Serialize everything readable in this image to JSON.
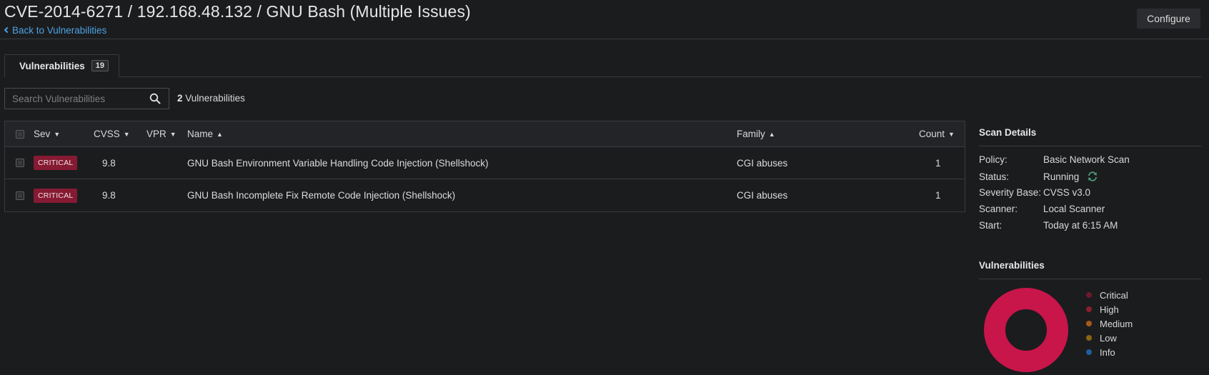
{
  "header": {
    "title": "CVE-2014-6271 / 192.168.48.132 / GNU Bash (Multiple Issues)",
    "back_label": "Back to Vulnerabilities",
    "configure_label": "Configure"
  },
  "tabs": [
    {
      "label": "Vulnerabilities",
      "count": "19"
    }
  ],
  "search": {
    "placeholder": "Search Vulnerabilities",
    "value": ""
  },
  "results": {
    "count": "2",
    "label": "Vulnerabilities"
  },
  "table": {
    "columns": {
      "sev": "Sev",
      "cvss": "CVSS",
      "vpr": "VPR",
      "name": "Name",
      "family": "Family",
      "count": "Count"
    },
    "sort_arrows": {
      "sev": "▼",
      "cvss": "▼",
      "vpr": "▼",
      "name": "▲",
      "family": "▲",
      "count": "▼"
    },
    "rows": [
      {
        "severity": "CRITICAL",
        "cvss": "9.8",
        "vpr": "",
        "name": "GNU Bash Environment Variable Handling Code Injection (Shellshock)",
        "family": "CGI abuses",
        "count": "1"
      },
      {
        "severity": "CRITICAL",
        "cvss": "9.8",
        "vpr": "",
        "name": "GNU Bash Incomplete Fix Remote Code Injection (Shellshock)",
        "family": "CGI abuses",
        "count": "1"
      }
    ]
  },
  "scan_details": {
    "title": "Scan Details",
    "fields": [
      {
        "key": "Policy:",
        "value": "Basic Network Scan"
      },
      {
        "key": "Status:",
        "value": "Running"
      },
      {
        "key": "Severity Base:",
        "value": "CVSS v3.0"
      },
      {
        "key": "Scanner:",
        "value": "Local Scanner"
      },
      {
        "key": "Start:",
        "value": "Today at 6:15 AM"
      }
    ]
  },
  "vuln_summary": {
    "title": "Vulnerabilities",
    "donut_color": "#c8154a",
    "legend": [
      {
        "label": "Critical",
        "color": "#6d1a2c"
      },
      {
        "label": "High",
        "color": "#8a1f2c"
      },
      {
        "label": "Medium",
        "color": "#a65a1a"
      },
      {
        "label": "Low",
        "color": "#8a6510"
      },
      {
        "label": "Info",
        "color": "#1f5e9c"
      }
    ]
  },
  "colors": {
    "background": "#1b1c1e",
    "accent_link": "#4ba3e3",
    "critical_badge": "#861a33",
    "running_icon": "#4b9e7a"
  }
}
